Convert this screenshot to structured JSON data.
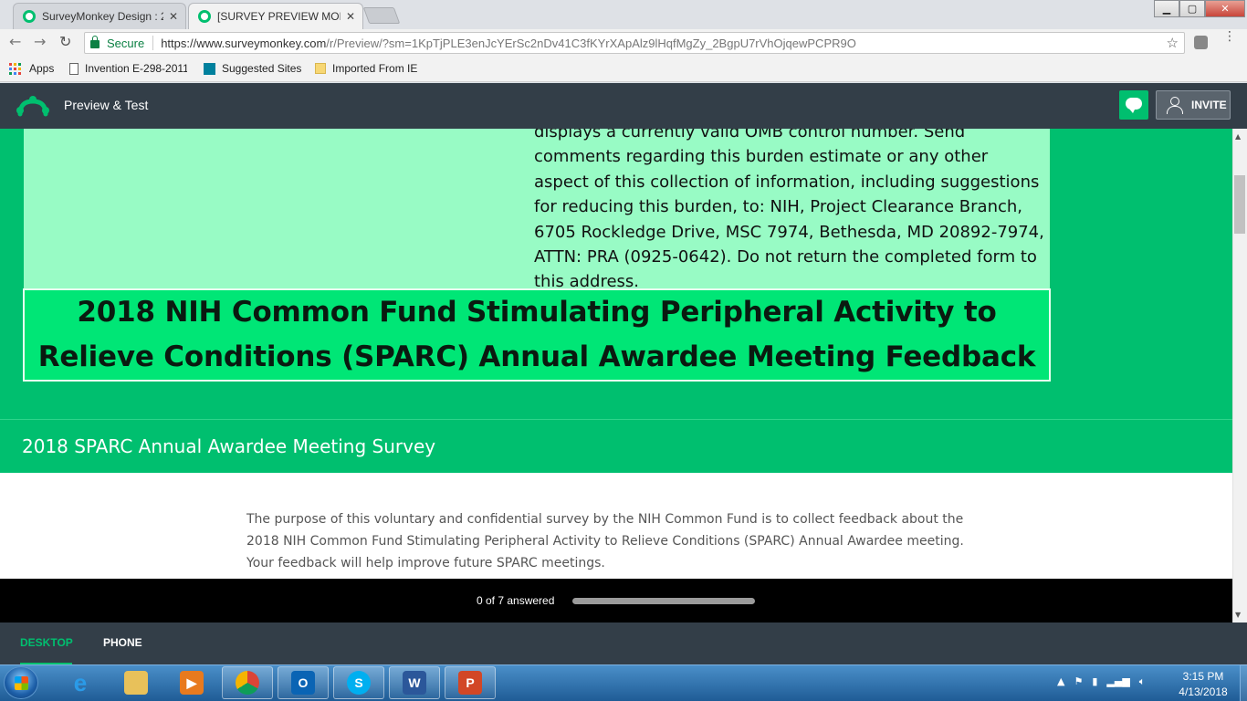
{
  "browser": {
    "tabs": [
      {
        "label": "SurveyMonkey Design : 2",
        "active": false
      },
      {
        "label": "[SURVEY PREVIEW MODE",
        "active": true
      }
    ],
    "url_secure_label": "Secure",
    "url_host": "https://www.surveymonkey.com",
    "url_path": "/r/Preview/?sm=1KpTjPLE3enJcYErSc2nDv41C3fKYrXApAlz9lHqfMgZy_2BgpU7rVhOjqewPCPR9O",
    "bookmarks": [
      {
        "label": "Apps",
        "icon": "apps-grid-icon"
      },
      {
        "label": "Invention E-298-2011",
        "icon": "page-icon"
      },
      {
        "label": "Suggested Sites",
        "icon": "bing-icon"
      },
      {
        "label": "Imported From IE",
        "icon": "folder-icon"
      }
    ],
    "window_controls": {
      "minimize": "▁",
      "maximize": "▢",
      "close": "✕"
    }
  },
  "sm_header": {
    "title": "Preview & Test",
    "invite_label": "INVITE"
  },
  "survey": {
    "burden_text": "displays a currently valid OMB control number. Send comments regarding this burden estimate or any other aspect of this collection of information, including suggestions for reducing this burden, to: NIH, Project Clearance Branch, 6705 Rockledge Drive, MSC 7974, Bethesda, MD 20892-7974, ATTN: PRA (0925-0642). Do not return the completed form to this address.",
    "banner_line1": "2018 NIH Common Fund Stimulating Peripheral Activity to",
    "banner_line2": "Relieve Conditions (SPARC) Annual Awardee Meeting Feedback",
    "title": "2018 SPARC Annual Awardee Meeting Survey",
    "purpose_line1": "The purpose of this voluntary and confidential survey by the NIH Common Fund is to collect feedback about the",
    "purpose_line2": "2018 NIH Common Fund Stimulating Peripheral Activity to Relieve Conditions (SPARC) Annual Awardee meeting.",
    "purpose_line3": "Your feedback will help improve future SPARC meetings."
  },
  "progress": {
    "label": "0 of 7 answered",
    "answered": 0,
    "total": 7
  },
  "device_tabs": {
    "desktop": "DESKTOP",
    "phone": "PHONE",
    "selected": "DESKTOP"
  },
  "taskbar": {
    "apps": [
      {
        "name": "internet-explorer",
        "glyph": "e",
        "color": "#1e90e0"
      },
      {
        "name": "file-explorer",
        "glyph": "",
        "color": "#e8c15a"
      },
      {
        "name": "media-player",
        "glyph": "▶",
        "color": "#e87a1e"
      },
      {
        "name": "chrome",
        "glyph": "",
        "color": "#db4437"
      },
      {
        "name": "outlook",
        "glyph": "O",
        "color": "#0a64b4"
      },
      {
        "name": "skype",
        "glyph": "S",
        "color": "#00aff0"
      },
      {
        "name": "word",
        "glyph": "W",
        "color": "#2b579a"
      },
      {
        "name": "powerpoint",
        "glyph": "P",
        "color": "#d24726"
      }
    ],
    "time": "3:15 PM",
    "date": "4/13/2018"
  },
  "colors": {
    "brand_green": "#00bf6f",
    "header_dark": "#333e48",
    "burden_bg": "#98fbc5",
    "banner_bg": "#00e676"
  }
}
